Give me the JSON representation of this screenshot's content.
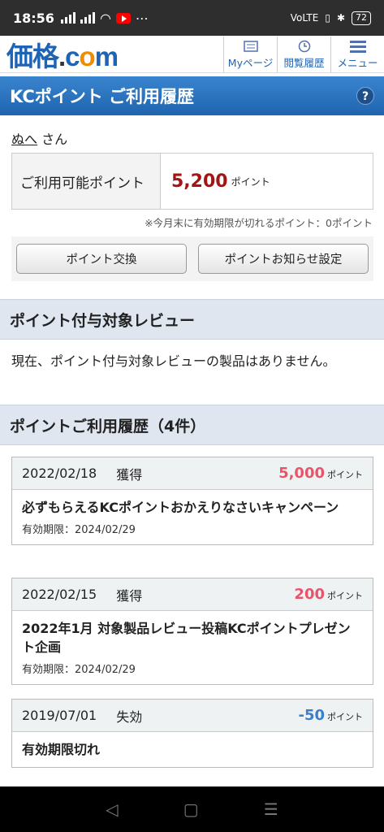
{
  "status_bar": {
    "time": "18:56",
    "battery": "72",
    "network": "VoLTE"
  },
  "header": {
    "logo_main": "価格",
    "logo_dot": ".",
    "logo_c": "c",
    "logo_o": "o",
    "logo_m": "m",
    "nav": [
      {
        "label": "Myページ",
        "icon": "mypage-icon"
      },
      {
        "label": "閲覧履歴",
        "icon": "history-clock-icon"
      },
      {
        "label": "メニュー",
        "icon": "hamburger-menu-icon"
      }
    ]
  },
  "page_title": "KCポイント ご利用履歴",
  "help_label": "?",
  "user": {
    "name": "ぬへ",
    "suffix": "さん"
  },
  "points": {
    "label": "ご利用可能ポイント",
    "value": "5,200",
    "unit": "ポイント",
    "expiry_note": "※今月末に有効期限が切れるポイント：0ポイント"
  },
  "buttons": {
    "exchange": "ポイント交換",
    "notify": "ポイントお知らせ設定"
  },
  "review_section": {
    "title": "ポイント付与対象レビュー",
    "message": "現在、ポイント付与対象レビューの製品はありません。"
  },
  "history_section": {
    "title": "ポイントご利用履歴（4件）",
    "entries": [
      {
        "date": "2022/02/18",
        "kind": "獲得",
        "amount": "5,000",
        "unit": "ポイント",
        "color": "#e8546a",
        "name": "必ずもらえるKCポイントおかえりなさいキャンペーン",
        "expiry": "有効期限：2024/02/29"
      },
      {
        "date": "2022/02/15",
        "kind": "獲得",
        "amount": "200",
        "unit": "ポイント",
        "color": "#e8546a",
        "name": "2022年1月 対象製品レビュー投稿KCポイントプレゼント企画",
        "expiry": "有効期限：2024/02/29"
      },
      {
        "date": "2019/07/01",
        "kind": "失効",
        "amount": "-50",
        "unit": "ポイント",
        "color": "#3a7fcc",
        "name": "有効期限切れ",
        "expiry": ""
      }
    ]
  },
  "colors": {
    "accent_blue": "#1f64ae",
    "point_red": "#a31515"
  }
}
